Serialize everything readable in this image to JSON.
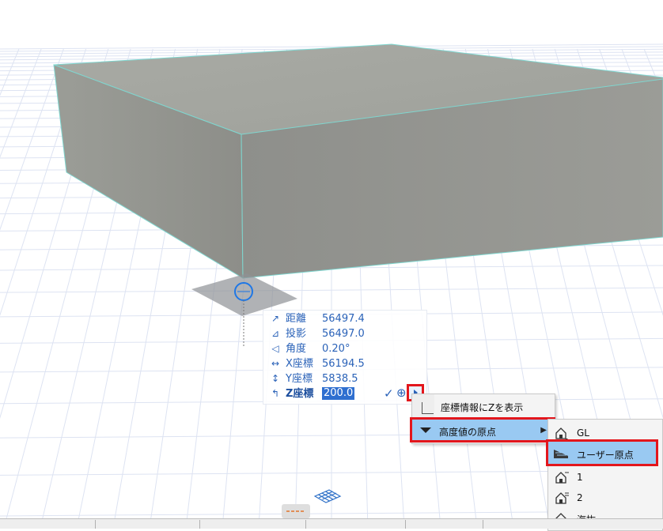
{
  "tracker": {
    "rows": [
      {
        "icon": "↗",
        "label": "距離",
        "value": "56497.4"
      },
      {
        "icon": "⊿",
        "label": "投影",
        "value": "56497.0"
      },
      {
        "icon": "◁",
        "label": "角度",
        "value": "0.20°"
      },
      {
        "icon": "↔",
        "label": "X座標",
        "value": "56194.5"
      },
      {
        "icon": "↕",
        "label": "Y座標",
        "value": "5838.5"
      },
      {
        "icon": "↰",
        "label": "Z座標",
        "value": "200.0"
      }
    ],
    "confirm_glyph": "✓",
    "target_glyph": "⊕"
  },
  "context_menu": {
    "items": [
      {
        "label": "座標情報にZを表示"
      },
      {
        "label": "高度値の原点",
        "submenu_glyph": "▶"
      }
    ]
  },
  "submenu": {
    "items": [
      {
        "label": "GL"
      },
      {
        "label": "ユーザー原点"
      },
      {
        "label": "1"
      },
      {
        "label": "2"
      },
      {
        "label": "海抜"
      }
    ]
  },
  "colors": {
    "accent_highlight": "#e3161c",
    "selection": "#99c9f2",
    "tracker_text": "#2a62b8"
  }
}
